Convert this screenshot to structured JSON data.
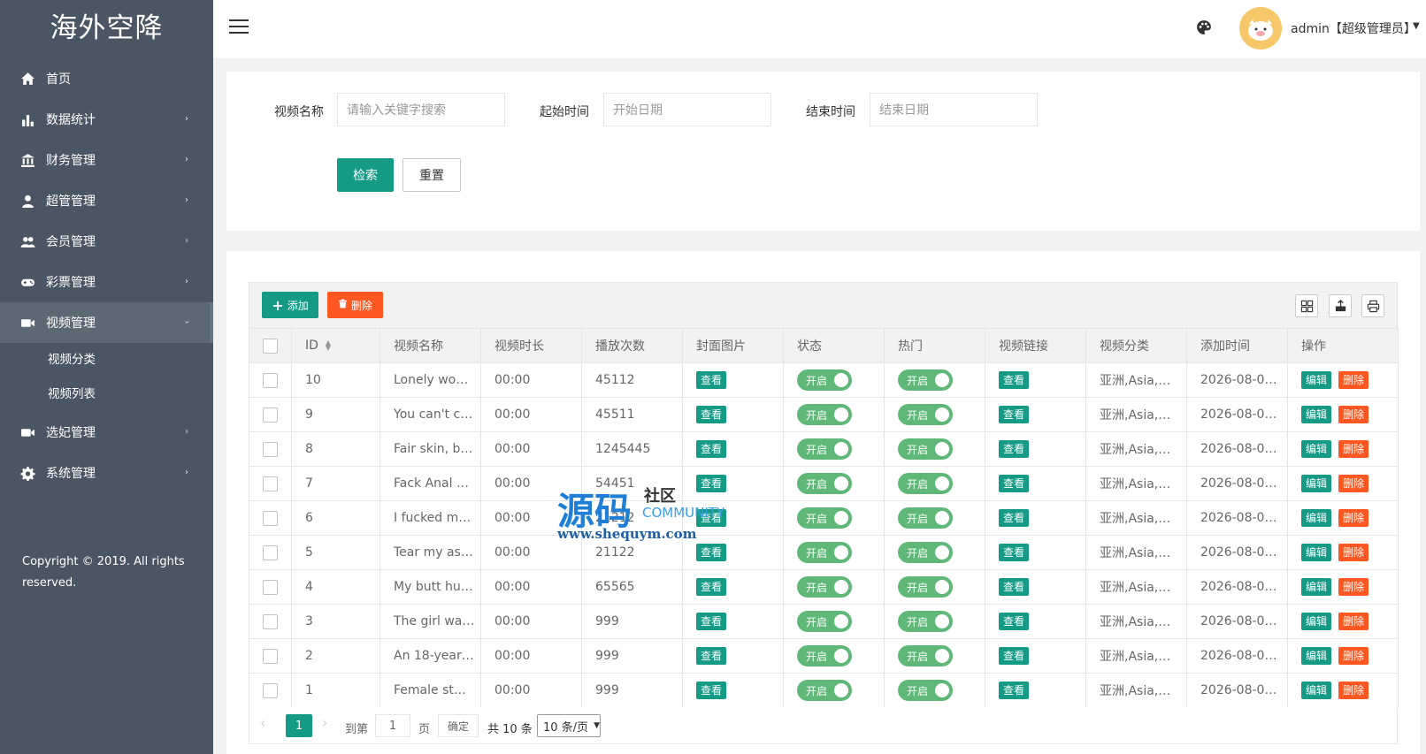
{
  "app": {
    "title": "海外空降"
  },
  "sidebar": {
    "items": [
      {
        "label": "首页",
        "icon": "home-icon",
        "arrow": ""
      },
      {
        "label": "数据统计",
        "icon": "bar-chart-icon",
        "arrow": "›"
      },
      {
        "label": "财务管理",
        "icon": "bank-icon",
        "arrow": "›"
      },
      {
        "label": "超管管理",
        "icon": "user-icon",
        "arrow": "›"
      },
      {
        "label": "会员管理",
        "icon": "users-icon",
        "arrow": "›"
      },
      {
        "label": "彩票管理",
        "icon": "gamepad-icon",
        "arrow": "›"
      },
      {
        "label": "视频管理",
        "icon": "video-icon",
        "arrow": "›"
      },
      {
        "label": "选妃管理",
        "icon": "video-icon",
        "arrow": "›"
      },
      {
        "label": "系统管理",
        "icon": "gear-icon",
        "arrow": "›"
      }
    ],
    "submenu": [
      "视频分类",
      "视频列表"
    ],
    "copyright": "Copyright © 2019. All rights reserved."
  },
  "header": {
    "user": "admin【超级管理员】"
  },
  "search": {
    "name_label": "视频名称",
    "name_placeholder": "请输入关键字搜索",
    "start_label": "起始时间",
    "start_placeholder": "开始日期",
    "end_label": "结束时间",
    "end_placeholder": "结束日期",
    "search_btn": "检索",
    "reset_btn": "重置"
  },
  "toolbar": {
    "add": "添加",
    "delete": "删除"
  },
  "table": {
    "columns": [
      "ID",
      "视频名称",
      "视频时长",
      "播放次数",
      "封面图片",
      "状态",
      "热门",
      "视频链接",
      "视频分类",
      "添加时间",
      "操作"
    ],
    "view_label": "查看",
    "switch_label": "开启",
    "edit_label": "编辑",
    "delete_label": "删除",
    "rows": [
      {
        "id": "10",
        "name": "Lonely wo…",
        "duration": "00:00",
        "plays": "45112",
        "category": "亚洲,Asia,…",
        "added": "2026-08-0…"
      },
      {
        "id": "9",
        "name": "You can't c…",
        "duration": "00:00",
        "plays": "45511",
        "category": "亚洲,Asia,…",
        "added": "2026-08-0…"
      },
      {
        "id": "8",
        "name": "Fair skin, b…",
        "duration": "00:00",
        "plays": "1245445",
        "category": "亚洲,Asia,…",
        "added": "2026-08-0…"
      },
      {
        "id": "7",
        "name": "Fack Anal …",
        "duration": "00:00",
        "plays": "54451",
        "category": "亚洲,Asia,…",
        "added": "2026-08-0…"
      },
      {
        "id": "6",
        "name": "I fucked m…",
        "duration": "00:00",
        "plays": "21212",
        "category": "亚洲,Asia,…",
        "added": "2026-08-0…"
      },
      {
        "id": "5",
        "name": "Tear my as…",
        "duration": "00:00",
        "plays": "21122",
        "category": "亚洲,Asia,…",
        "added": "2026-08-0…"
      },
      {
        "id": "4",
        "name": "My butt hu…",
        "duration": "00:00",
        "plays": "65565",
        "category": "亚洲,Asia,…",
        "added": "2026-08-0…"
      },
      {
        "id": "3",
        "name": "The girl wa…",
        "duration": "00:00",
        "plays": "999",
        "category": "亚洲,Asia,…",
        "added": "2026-08-0…"
      },
      {
        "id": "2",
        "name": "An 18-year…",
        "duration": "00:00",
        "plays": "999",
        "category": "亚洲,Asia,…",
        "added": "2026-08-0…"
      },
      {
        "id": "1",
        "name": "Female st…",
        "duration": "00:00",
        "plays": "999",
        "category": "亚洲,Asia,…",
        "added": "2026-08-0…"
      }
    ]
  },
  "pagination": {
    "current": "1",
    "goto_label": "到第",
    "goto_value": "1",
    "page_label": "页",
    "confirm": "确定",
    "total": "共 10 条",
    "per_page": "10 条/页"
  },
  "watermark": {
    "big": "源码",
    "small": "社区",
    "en": "COMMUNITY",
    "url": "www.shequym.com"
  },
  "colors": {
    "sidebar_bg": "#4a5664",
    "primary": "#159a86",
    "danger": "#ff5722",
    "switch_on": "#5fb878"
  }
}
